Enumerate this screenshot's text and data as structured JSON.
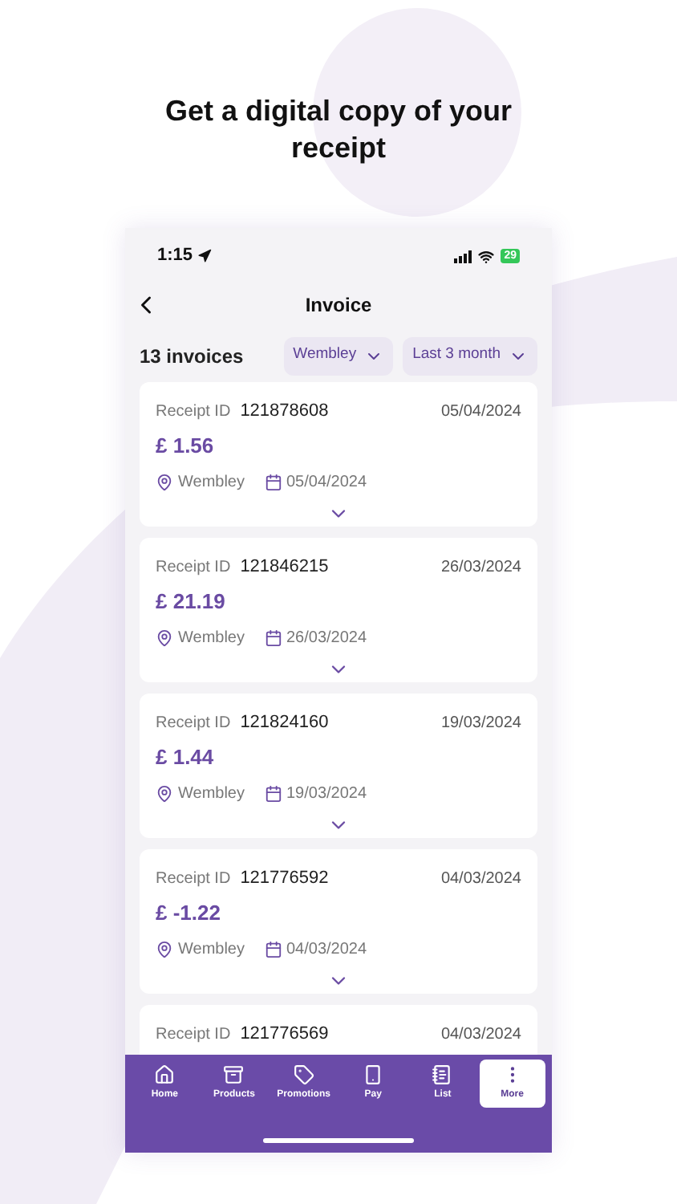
{
  "headline": "Get a digital copy of your receipt",
  "status_bar": {
    "time": "1:15",
    "battery": "29"
  },
  "header": {
    "title": "Invoice"
  },
  "summary": {
    "count": "13 invoices",
    "filters": [
      {
        "label": "Wembley"
      },
      {
        "label": "Last 3 month"
      }
    ]
  },
  "receipts": [
    {
      "id_label": "Receipt ID",
      "id": "121878608",
      "date": "05/04/2024",
      "amount": "£ 1.56",
      "store": "Wembley",
      "purchase_date": "05/04/2024"
    },
    {
      "id_label": "Receipt ID",
      "id": "121846215",
      "date": "26/03/2024",
      "amount": "£ 21.19",
      "store": "Wembley",
      "purchase_date": "26/03/2024"
    },
    {
      "id_label": "Receipt ID",
      "id": "121824160",
      "date": "19/03/2024",
      "amount": "£ 1.44",
      "store": "Wembley",
      "purchase_date": "19/03/2024"
    },
    {
      "id_label": "Receipt ID",
      "id": "121776592",
      "date": "04/03/2024",
      "amount": "£ -1.22",
      "store": "Wembley",
      "purchase_date": "04/03/2024"
    },
    {
      "id_label": "Receipt ID",
      "id": "121776569",
      "date": "04/03/2024"
    }
  ],
  "tab_bar": [
    {
      "label": "Home",
      "selected": false
    },
    {
      "label": "Products",
      "selected": false
    },
    {
      "label": "Promotions",
      "selected": false
    },
    {
      "label": "Pay",
      "selected": false
    },
    {
      "label": "List",
      "selected": false
    },
    {
      "label": "More",
      "selected": true
    }
  ]
}
